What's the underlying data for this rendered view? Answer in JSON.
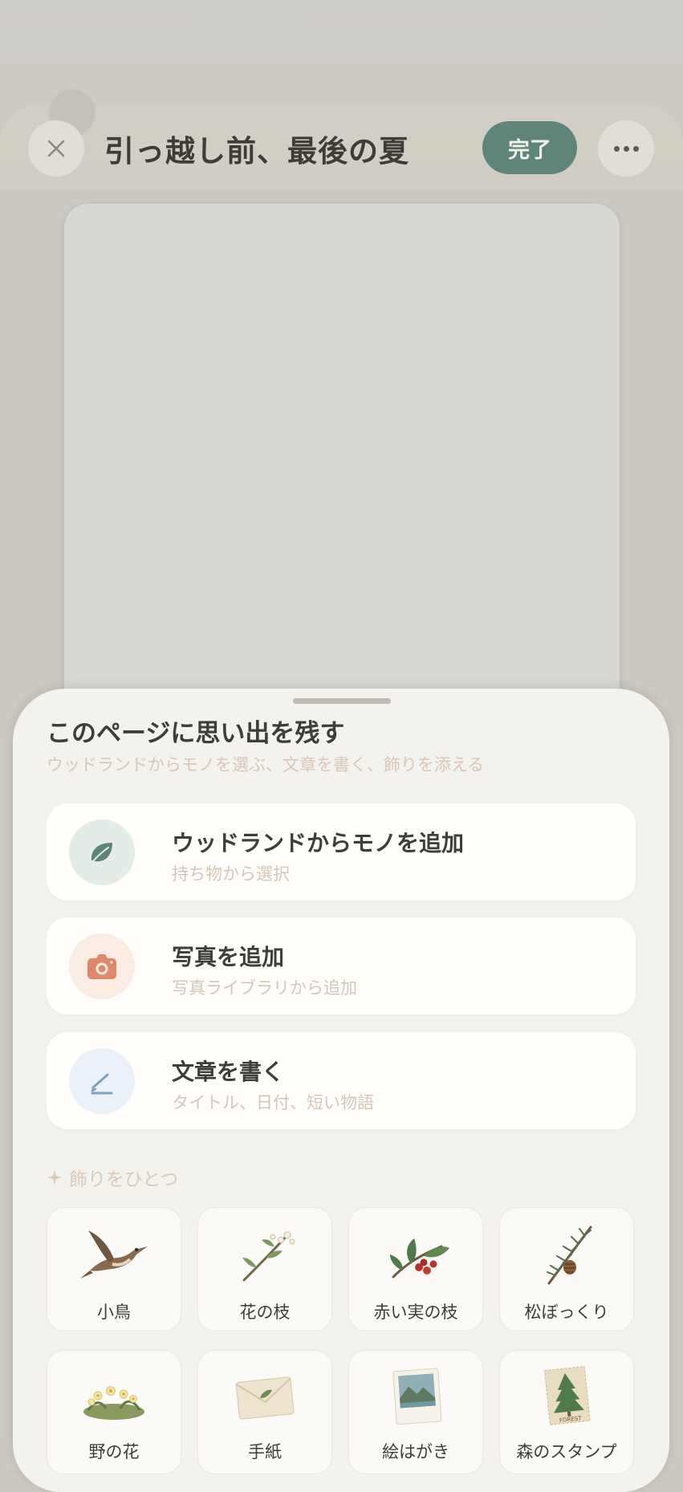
{
  "header": {
    "title": "引っ越し前、最後の夏",
    "done_label": "完了",
    "close_icon": "close-icon",
    "more_icon": "more-horizontal-icon"
  },
  "sheet": {
    "title": "このページに思い出を残す",
    "subtitle": "ウッドランドからモノを選ぶ、文章を書く、飾りを添える",
    "actions": [
      {
        "label": "ウッドランドからモノを追加",
        "description": "持ち物から選択",
        "icon": "leaf-icon",
        "icon_bg": "#e4ece7",
        "icon_color": "#5e8578"
      },
      {
        "label": "写真を追加",
        "description": "写真ライブラリから追加",
        "icon": "camera-icon",
        "icon_bg": "#fbece4",
        "icon_color": "#e0896a"
      },
      {
        "label": "文章を書く",
        "description": "タイトル、日付、短い物語",
        "icon": "pen-icon",
        "icon_bg": "#eaf1f8",
        "icon_color": "#7ea1c4"
      }
    ],
    "decorations_heading": "飾りをひとつ",
    "decorations_heading_icon": "sparkle-icon",
    "decorations": [
      {
        "label": "小鳥",
        "icon": "bird-icon"
      },
      {
        "label": "花の枝",
        "icon": "flower-branch-icon"
      },
      {
        "label": "赤い実の枝",
        "icon": "red-berry-branch-icon"
      },
      {
        "label": "松ぼっくり",
        "icon": "pinecone-icon"
      },
      {
        "label": "野の花",
        "icon": "wildflower-icon"
      },
      {
        "label": "手紙",
        "icon": "letter-icon"
      },
      {
        "label": "絵はがき",
        "icon": "postcard-icon"
      },
      {
        "label": "森のスタンプ",
        "icon": "forest-stamp-icon"
      }
    ],
    "stamp_text": "FOREST"
  },
  "colors": {
    "accent": "#5e8578",
    "backdrop": "#cbc9c2",
    "sheet_bg": "#f4f2ed"
  }
}
